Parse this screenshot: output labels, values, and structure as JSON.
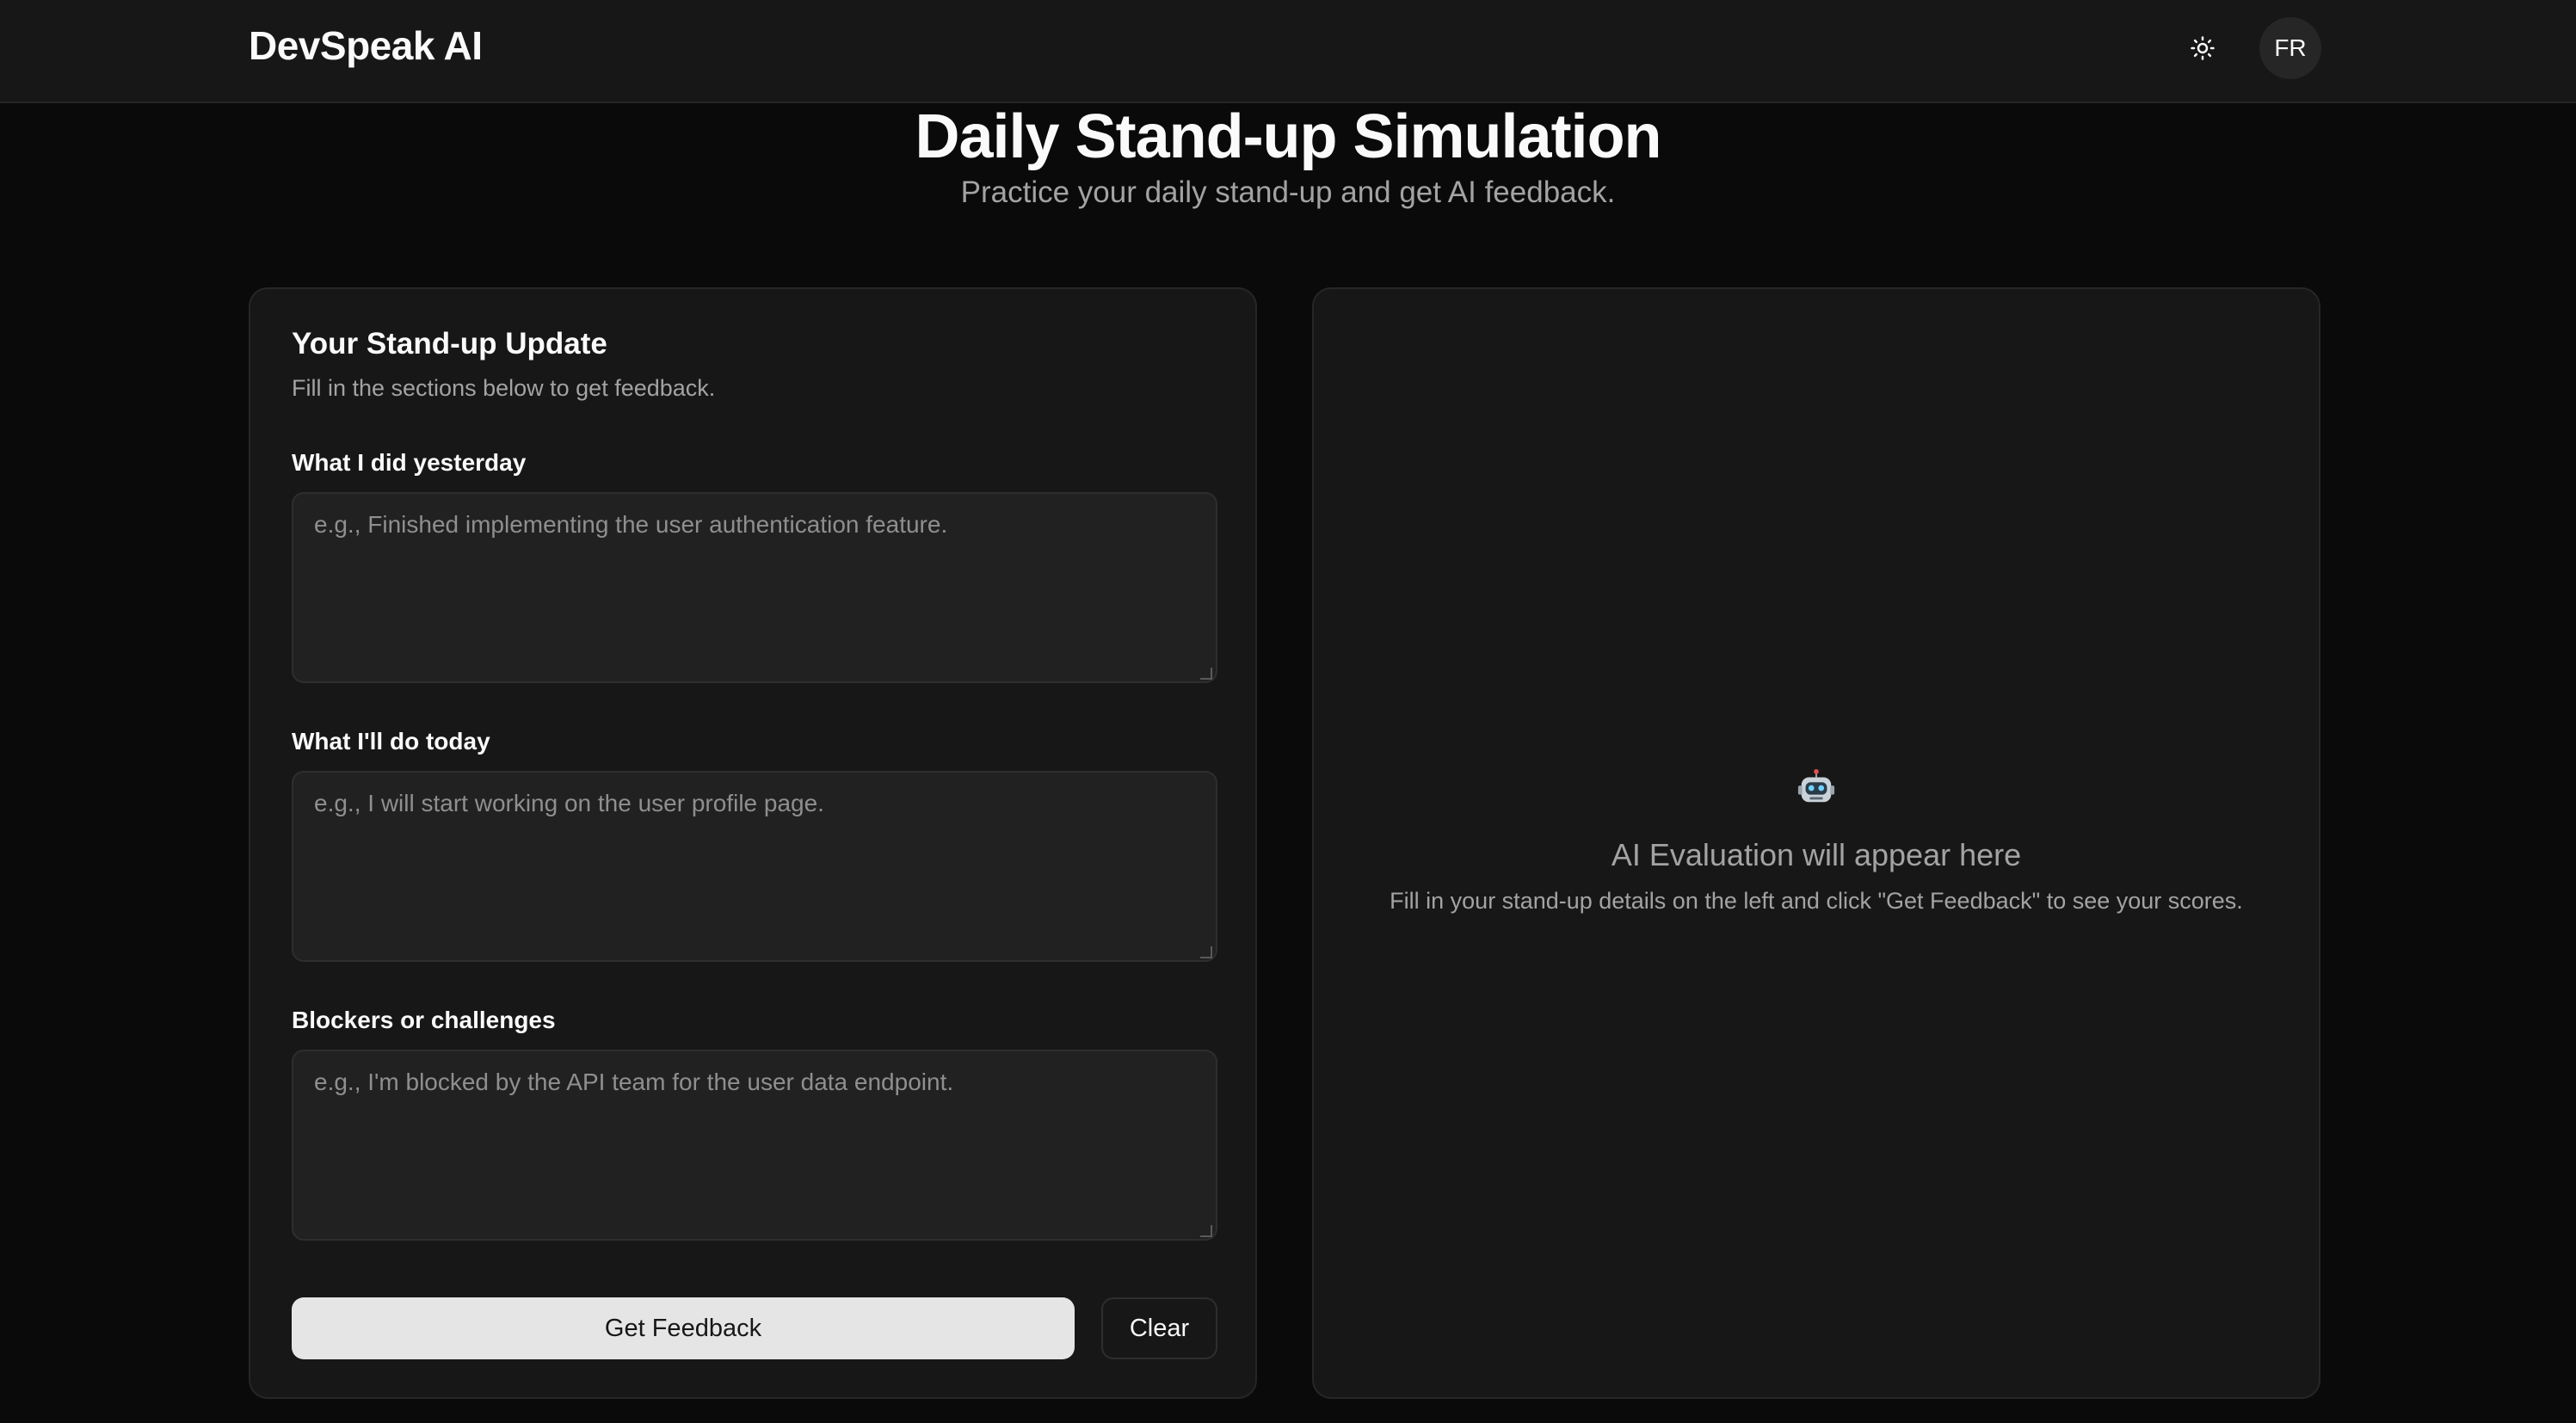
{
  "header": {
    "brand": "DevSpeak AI",
    "theme_icon": "sun-icon",
    "avatar_initials": "FR"
  },
  "page": {
    "title": "Daily Stand-up Simulation",
    "subtitle": "Practice your daily stand-up and get AI feedback."
  },
  "form": {
    "title": "Your Stand-up Update",
    "description": "Fill in the sections below to get feedback.",
    "fields": [
      {
        "label": "What I did yesterday",
        "placeholder": "e.g., Finished implementing the user authentication feature.",
        "value": ""
      },
      {
        "label": "What I'll do today",
        "placeholder": "e.g., I will start working on the user profile page.",
        "value": ""
      },
      {
        "label": "Blockers or challenges",
        "placeholder": "e.g., I'm blocked by the API team for the user data endpoint.",
        "value": ""
      }
    ],
    "submit_label": "Get Feedback",
    "clear_label": "Clear"
  },
  "evaluation": {
    "icon": "robot-icon",
    "title": "AI Evaluation will appear here",
    "description": "Fill in your stand-up details on the left and click \"Get Feedback\" to see your scores."
  },
  "colors": {
    "background": "#0a0a0a",
    "surface": "#171717",
    "border": "#262626",
    "primary_button": "#e5e5e5",
    "muted_text": "#a3a3a3"
  }
}
